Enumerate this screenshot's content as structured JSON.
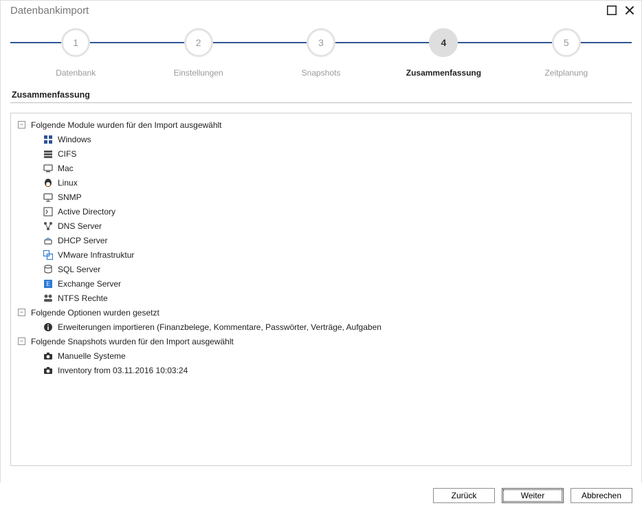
{
  "window": {
    "title": "Datenbankimport"
  },
  "stepper": {
    "steps": [
      {
        "num": "1",
        "label": "Datenbank"
      },
      {
        "num": "2",
        "label": "Einstellungen"
      },
      {
        "num": "3",
        "label": "Snapshots"
      },
      {
        "num": "4",
        "label": "Zusammenfassung"
      },
      {
        "num": "5",
        "label": "Zeitplanung"
      }
    ],
    "active_index": 3
  },
  "section": {
    "title": "Zusammenfassung"
  },
  "summary": {
    "group_modules": {
      "label": "Folgende Module wurden für den Import ausgewählt",
      "items": [
        {
          "icon": "windows",
          "label": "Windows"
        },
        {
          "icon": "cifs",
          "label": "CIFS"
        },
        {
          "icon": "mac",
          "label": "Mac"
        },
        {
          "icon": "linux",
          "label": "Linux"
        },
        {
          "icon": "snmp",
          "label": "SNMP"
        },
        {
          "icon": "ad",
          "label": "Active Directory"
        },
        {
          "icon": "dns",
          "label": "DNS Server"
        },
        {
          "icon": "dhcp",
          "label": "DHCP Server"
        },
        {
          "icon": "vmware",
          "label": "VMware Infrastruktur"
        },
        {
          "icon": "sql",
          "label": "SQL Server"
        },
        {
          "icon": "exchange",
          "label": "Exchange Server"
        },
        {
          "icon": "ntfs",
          "label": "NTFS Rechte"
        }
      ]
    },
    "group_options": {
      "label": "Folgende Optionen wurden gesetzt",
      "items": [
        {
          "icon": "info",
          "label": "Erweiterungen importieren (Finanzbelege, Kommentare, Passwörter, Verträge, Aufgaben"
        }
      ]
    },
    "group_snapshots": {
      "label": "Folgende Snapshots wurden für den Import ausgewählt",
      "items": [
        {
          "icon": "camera",
          "label": "Manuelle Systeme"
        },
        {
          "icon": "camera",
          "label": "Inventory from 03.11.2016 10:03:24"
        }
      ]
    }
  },
  "buttons": {
    "back": "Zurück",
    "next": "Weiter",
    "cancel": "Abbrechen"
  }
}
